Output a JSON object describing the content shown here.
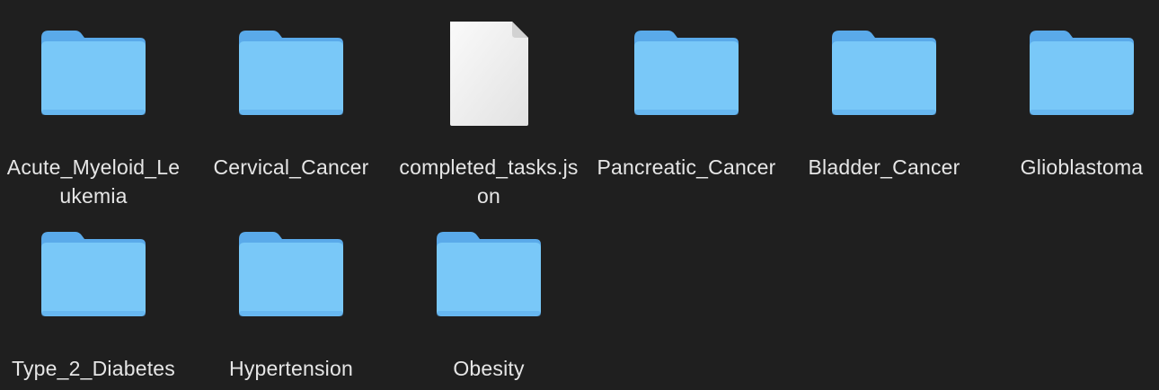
{
  "colors": {
    "background": "#1f1f1f",
    "folder_back": "#5aaaea",
    "folder_front": "#79c8f8",
    "file_page": "#f2f2f2",
    "label_text": "#e6e6e6"
  },
  "items": [
    {
      "name": "Acute_Myeloid_Leukemia",
      "kind": "folder",
      "icon": "folder-icon"
    },
    {
      "name": "Cervical_Cancer",
      "kind": "folder",
      "icon": "folder-icon"
    },
    {
      "name": "completed_tasks.json",
      "kind": "file",
      "icon": "document-icon"
    },
    {
      "name": "Pancreatic_Cancer",
      "kind": "folder",
      "icon": "folder-icon"
    },
    {
      "name": "Bladder_Cancer",
      "kind": "folder",
      "icon": "folder-icon"
    },
    {
      "name": "Glioblastoma",
      "kind": "folder",
      "icon": "folder-icon"
    },
    {
      "name": "Type_2_Diabetes",
      "kind": "folder",
      "icon": "folder-icon"
    },
    {
      "name": "Hypertension",
      "kind": "folder",
      "icon": "folder-icon"
    },
    {
      "name": "Obesity",
      "kind": "folder",
      "icon": "folder-icon"
    }
  ]
}
